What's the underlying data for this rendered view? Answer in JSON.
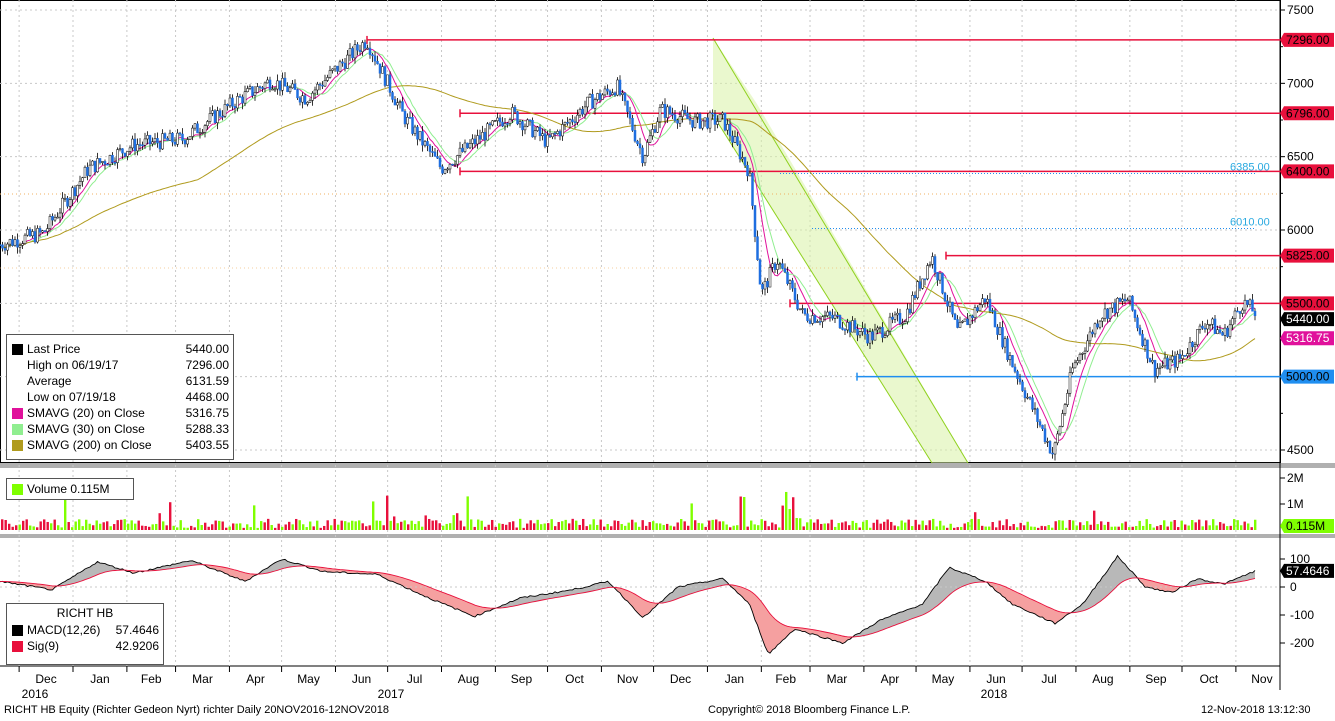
{
  "chart_data": {
    "type": "line",
    "x_axis": {
      "months": [
        "Dec",
        "Jan",
        "Feb",
        "Mar",
        "Apr",
        "May",
        "Jun",
        "Jul",
        "Aug",
        "Sep",
        "Oct",
        "Nov",
        "Dec",
        "Jan",
        "Feb",
        "Mar",
        "Apr",
        "May",
        "Jun",
        "Jul",
        "Aug",
        "Sep",
        "Oct",
        "Nov"
      ],
      "years": [
        "2016",
        "2017",
        "2018"
      ]
    },
    "price_panel": {
      "y_ticks": [
        7500,
        7000,
        6500,
        6000,
        5500,
        5000,
        4500
      ],
      "ylim": [
        4400,
        7560
      ],
      "horizontal_levels": [
        {
          "label": "7296.00",
          "value": 7296,
          "color": "#e8103c"
        },
        {
          "label": "6796.00",
          "value": 6796,
          "color": "#e8103c"
        },
        {
          "label": "6400.00",
          "value": 6400,
          "color": "#e8103c"
        },
        {
          "label": "5825.00",
          "value": 5825,
          "color": "#e8103c"
        },
        {
          "label": "5500.00",
          "value": 5500,
          "color": "#e8103c"
        },
        {
          "label": "5000.00",
          "value": 5000,
          "color": "#1f8ef0"
        }
      ],
      "fib_labels": [
        {
          "label": "6385.00",
          "value": 6385
        },
        {
          "label": "6010.00",
          "value": 6010
        }
      ],
      "last_price_tag": "5440.00",
      "sma20_tag": "5316.75",
      "legend": [
        {
          "name": "Last Price",
          "value": "5440.00",
          "color": "#000000"
        },
        {
          "name": "High on 06/19/17",
          "value": "7296.00",
          "color": ""
        },
        {
          "name": "Average",
          "value": "6131.59",
          "color": ""
        },
        {
          "name": "Low on 07/19/18",
          "value": "4468.00",
          "color": ""
        },
        {
          "name": "SMAVG (20)  on Close",
          "value": "5316.75",
          "color": "#e0119b"
        },
        {
          "name": "SMAVG (30)  on Close",
          "value": "5288.33",
          "color": "#90ee90"
        },
        {
          "name": "SMAVG (200)  on Close",
          "value": "5403.55",
          "color": "#b09b1e"
        }
      ],
      "close_series": {
        "x": [
          "2016-11-20",
          "2016-12-15",
          "2017-01-10",
          "2017-02-05",
          "2017-03-05",
          "2017-04-05",
          "2017-04-25",
          "2017-05-15",
          "2017-06-19",
          "2017-07-10",
          "2017-08-01",
          "2017-08-20",
          "2017-09-10",
          "2017-10-01",
          "2017-10-25",
          "2017-11-10",
          "2017-11-25",
          "2017-12-05",
          "2017-12-25",
          "2018-01-10",
          "2018-01-25",
          "2018-02-01",
          "2018-02-10",
          "2018-02-25",
          "2018-03-15",
          "2018-04-05",
          "2018-04-25",
          "2018-05-10",
          "2018-05-25",
          "2018-06-10",
          "2018-06-25",
          "2018-07-19",
          "2018-07-30",
          "2018-08-15",
          "2018-08-31",
          "2018-09-15",
          "2018-09-30",
          "2018-10-15",
          "2018-10-25",
          "2018-11-05",
          "2018-11-12"
        ],
        "y": [
          5900,
          5980,
          6420,
          6580,
          6620,
          6880,
          7020,
          6900,
          7296,
          6780,
          6420,
          6600,
          6800,
          6600,
          6870,
          6980,
          6500,
          6820,
          6740,
          6750,
          6400,
          5560,
          5800,
          5420,
          5400,
          5270,
          5420,
          5820,
          5300,
          5540,
          5100,
          4468,
          5050,
          5420,
          5530,
          5050,
          5120,
          5380,
          5280,
          5510,
          5440
        ]
      }
    },
    "volume_panel": {
      "legend": "Volume 0.115M",
      "y_ticks": [
        "2M",
        "1M"
      ],
      "last_tag": "0.115M"
    },
    "macd_panel": {
      "title": "RICHT HB",
      "y_ticks": [
        "100",
        "0",
        "-100",
        "-200"
      ],
      "legend": [
        {
          "name": "MACD(12,26)",
          "value": "57.4646",
          "color": "#000000"
        },
        {
          "name": "Sig(9)",
          "value": "42.9206",
          "color": "#e8103c"
        }
      ],
      "last_tag": "57.4646",
      "macd_series": {
        "x": [
          "2016-11-20",
          "2016-12-20",
          "2017-01-15",
          "2017-02-05",
          "2017-03-10",
          "2017-04-10",
          "2017-05-01",
          "2017-05-25",
          "2017-06-25",
          "2017-07-25",
          "2017-08-20",
          "2017-09-15",
          "2017-10-15",
          "2017-11-05",
          "2017-11-25",
          "2017-12-15",
          "2018-01-10",
          "2018-01-25",
          "2018-02-05",
          "2018-02-20",
          "2018-03-20",
          "2018-04-10",
          "2018-05-05",
          "2018-05-20",
          "2018-06-10",
          "2018-06-25",
          "2018-07-20",
          "2018-08-05",
          "2018-08-25",
          "2018-09-10",
          "2018-09-25",
          "2018-10-10",
          "2018-10-25",
          "2018-11-12"
        ],
        "y": [
          20,
          -10,
          90,
          50,
          95,
          20,
          100,
          55,
          45,
          -40,
          -105,
          -40,
          -10,
          20,
          -110,
          0,
          30,
          -60,
          -240,
          -150,
          -200,
          -120,
          -60,
          70,
          20,
          -60,
          -130,
          -60,
          110,
          0,
          -20,
          30,
          10,
          57.46
        ]
      }
    }
  },
  "footer": {
    "left": "RICHT HB Equity (Richter Gedeon Nyrt) richter  Daily 20NOV2016-12NOV2018",
    "center": "Copyright© 2018 Bloomberg Finance L.P.",
    "right": "12-Nov-2018 13:12:30"
  }
}
